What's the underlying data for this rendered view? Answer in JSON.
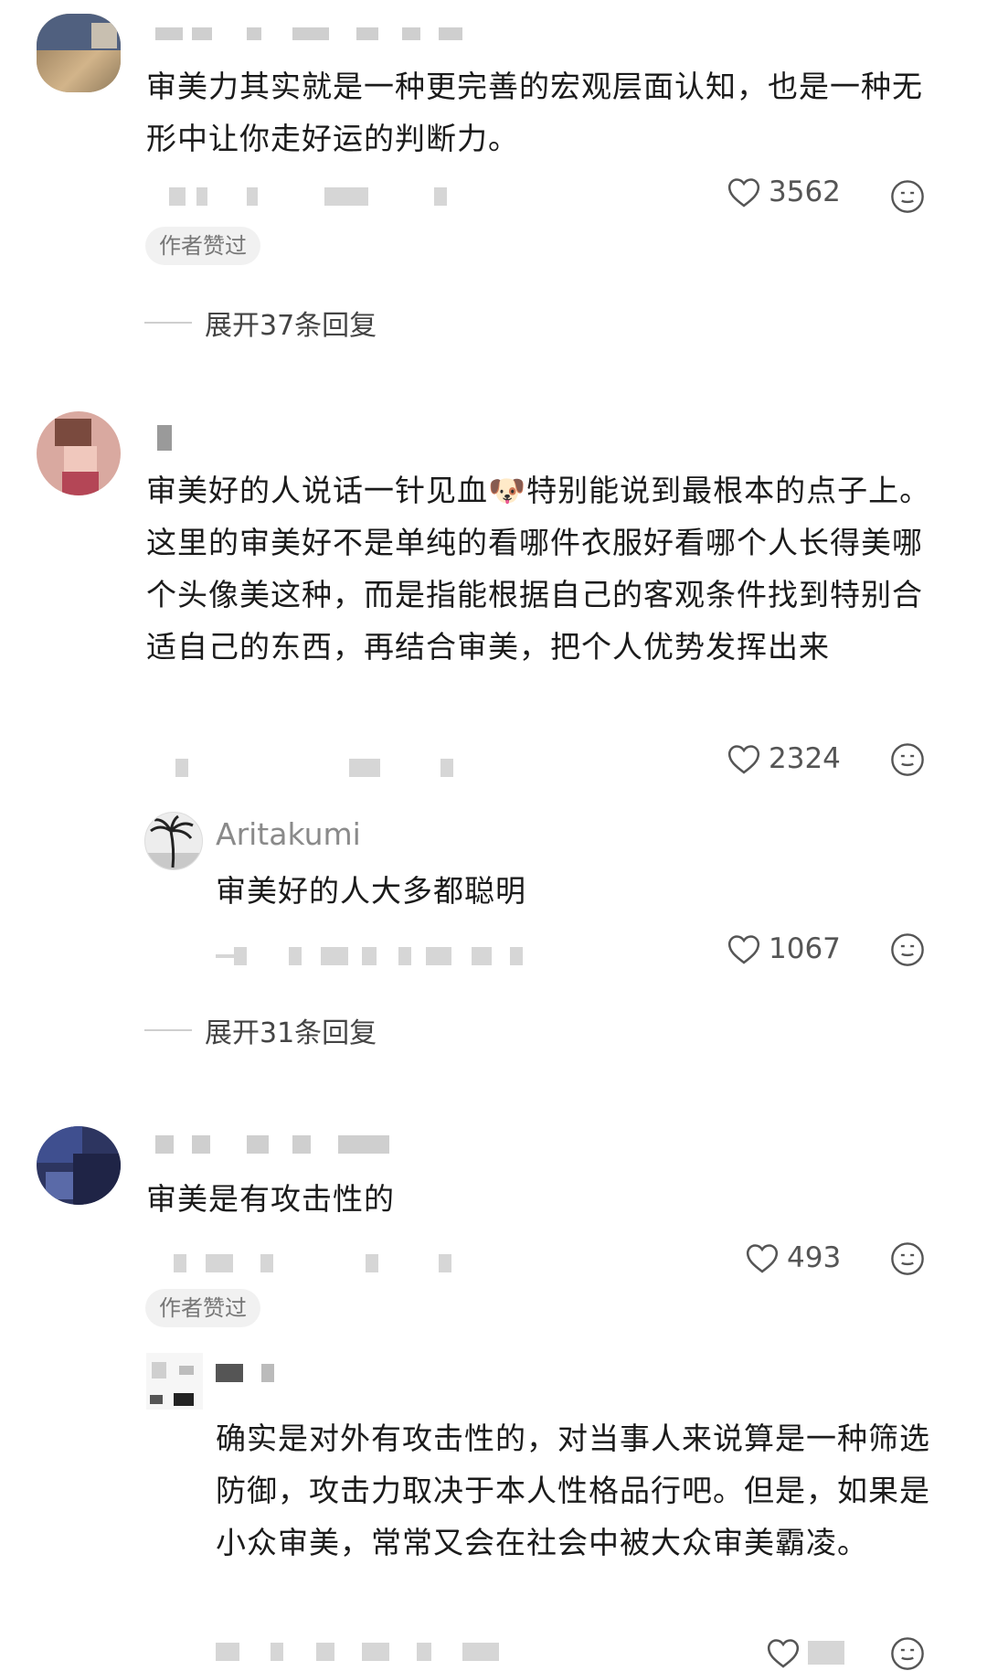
{
  "comments": [
    {
      "text": "审美力其实就是一种更完善的宏观层面认知，也是一种无形中让你走好运的判断力。",
      "likes": "3562",
      "badge": "作者赞过",
      "expand": "展开37条回复"
    },
    {
      "text": "审美好的人说话一针见血🐶特别能说到最根本的点子上。这里的审美好不是单纯的看哪件衣服好看哪个人长得美哪个头像美这种，而是指能根据自己的客观条件找到特别合适自己的东西，再结合审美，把个人优势发挥出来",
      "likes": "2324",
      "reply": {
        "user": "Aritakumi",
        "text": "审美好的人大多都聪明",
        "likes": "1067"
      },
      "expand": "展开31条回复"
    },
    {
      "text": "审美是有攻击性的",
      "likes": "493",
      "badge": "作者赞过",
      "reply": {
        "text": "确实是对外有攻击性的，对当事人来说算是一种筛选防御，攻击力取决于本人性格品行吧。但是，如果是小众审美，常常又会在社会中被大众审美霸凌。"
      }
    }
  ],
  "icons": {
    "like": "heart-outline-icon",
    "react": "emoji-face-icon",
    "emoji_inline": "dog-face-emoji"
  },
  "colors": {
    "text": "#1b1b1b",
    "muted": "#555555",
    "badge_bg": "#f1f1f1"
  }
}
